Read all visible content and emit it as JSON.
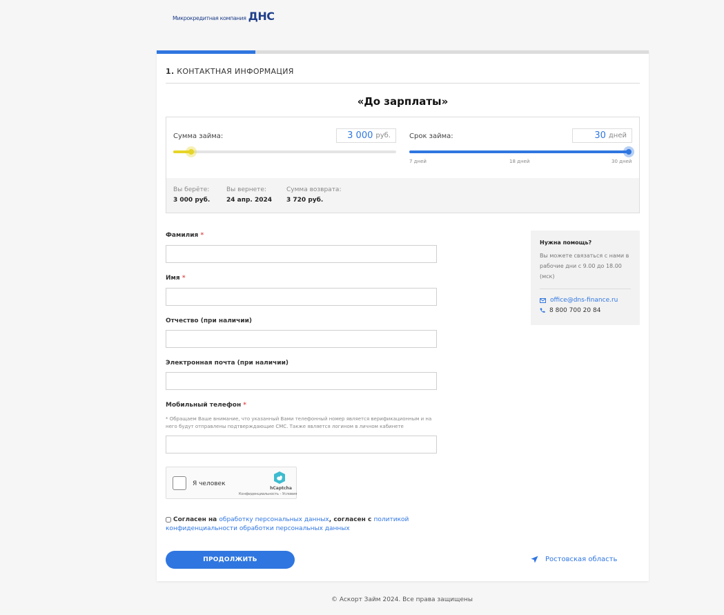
{
  "logo": {
    "small": "Микрокредитная компания",
    "big": "ДНС"
  },
  "progress_fraction": 0.2,
  "step": {
    "number": "1.",
    "title": "КОНТАКТНАЯ ИНФОРМАЦИЯ"
  },
  "product_title": "«До зарплаты»",
  "loan_amount": {
    "label": "Сумма займа:",
    "value": "3 000",
    "unit": "руб.",
    "slider_fraction": 0.08
  },
  "loan_term": {
    "label": "Срок займа:",
    "value": "30",
    "unit": "дней",
    "slider_fraction": 1.0,
    "ticks": [
      "7 дней",
      "18 дней",
      "30 дней"
    ]
  },
  "summary": [
    {
      "label": "Вы берёте:",
      "value": "3 000 руб."
    },
    {
      "label": "Вы вернете:",
      "value": "24 апр. 2024"
    },
    {
      "label": "Сумма возврата:",
      "value": "3 720 руб."
    }
  ],
  "fields": {
    "last_name": {
      "label": "Фамилия",
      "required": "*"
    },
    "first_name": {
      "label": "Имя",
      "required": "*"
    },
    "patronymic": {
      "label": "Отчество (при наличии)"
    },
    "email": {
      "label": "Электронная почта (при наличии)"
    },
    "phone": {
      "label": "Мобильный телефон",
      "required": "*",
      "note": "* Обращаем Ваше внимание, что указанный Вами телефонный номер является верификационным и на него будут отправлены подтверждающие СМС. Также является логином в личном кабинете"
    }
  },
  "captcha": {
    "label": "Я человек",
    "brand": "hCaptcha",
    "links": "Конфиденциальность - Условия"
  },
  "consent": {
    "text1": "Согласен на",
    "link1": "обработку персональных данных",
    "text2": ", согласен с",
    "link2": "политикой конфиденциальности обработки персональных данных"
  },
  "continue_button": "ПРОДОЛЖИТЬ",
  "region": "Ростовская область",
  "help": {
    "title": "Нужна помощь?",
    "text": "Вы можете связаться с нами в рабочие дни с 9.00 до 18.00 (мск)",
    "email": "office@dns-finance.ru",
    "phone": "8 800 700 20 84"
  },
  "footer": "© Аскорт Займ 2024. Все права защищены",
  "colors": {
    "accent": "#2f76e0",
    "slider_amount": "#e6d527",
    "brand": "#1f3f8a"
  }
}
